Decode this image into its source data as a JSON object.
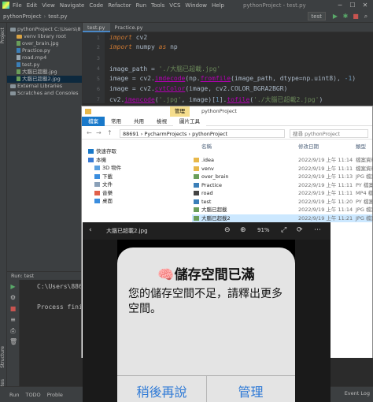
{
  "menubar": {
    "items": [
      "File",
      "Edit",
      "View",
      "Navigate",
      "Code",
      "Refactor",
      "Run",
      "Tools",
      "VCS",
      "Window",
      "Help"
    ],
    "window_title": "pythonProject - test.py"
  },
  "navbar": {
    "crumbs": [
      "pythonProject",
      "test.py"
    ],
    "run_config": "test"
  },
  "left_strip": {
    "project_label": "Project",
    "structure_label": "Structure",
    "favorites_label": "Favorites"
  },
  "project_tree": [
    {
      "label": "pythonProject  C:\\Users\\8",
      "kind": "folder"
    },
    {
      "label": "venv  library root",
      "kind": "folder-orange"
    },
    {
      "label": "over_brain.jpg",
      "kind": "img"
    },
    {
      "label": "Practice.py",
      "kind": "py"
    },
    {
      "label": "road.mp4",
      "kind": "file"
    },
    {
      "label": "test.py",
      "kind": "py"
    },
    {
      "label": "大腦已超載.jpg",
      "kind": "img"
    },
    {
      "label": "大腦已超載2.jpg",
      "kind": "img",
      "selected": true
    },
    {
      "label": "External Libraries",
      "kind": "folder"
    },
    {
      "label": "Scratches and Consoles",
      "kind": "folder"
    }
  ],
  "editor": {
    "tabs": [
      {
        "label": "test.py",
        "active": true
      },
      {
        "label": "Practice.py",
        "active": false
      }
    ],
    "line_numbers": [
      "1",
      "2",
      "3",
      "4",
      "5",
      "6",
      "7"
    ],
    "lines": [
      "import cv2",
      "import numpy as np",
      "",
      "image_path = './大腦已超載.jpg'",
      "image = cv2.imdecode(np.fromfile(image_path, dtype=np.uint8), -1)",
      "image = cv2.cvtColor(image, cv2.COLOR_BGRA2BGR)",
      "cv2.imencode('.jpg', image)[1].tofile('./大腦已超載2.jpg')"
    ]
  },
  "run_panel": {
    "header": "Run:   test",
    "output_lines": [
      "C:\\Users\\8869",
      "",
      "Process finis"
    ]
  },
  "statusbar": {
    "items": [
      "Run",
      "TODO",
      "Proble"
    ],
    "right": "Event Log"
  },
  "explorer": {
    "manage_tab": "管理",
    "title": "pythonProject",
    "ribbon_tabs": [
      "檔案",
      "常用",
      "共用",
      "檢視",
      "圖片工具"
    ],
    "address": "88691 › PycharmProjects › pythonProject",
    "search_placeholder": "搜尋 pythonProject",
    "nav_items": [
      "快速存取",
      "本機",
      "3D 物件",
      "下載",
      "文件",
      "音樂",
      "桌面"
    ],
    "columns": [
      "名稱",
      "修改日期",
      "類型"
    ],
    "files": [
      {
        "name": ".idea",
        "date": "2022/9/19 上午 11:14",
        "type": "檔案資料",
        "kind": "folder"
      },
      {
        "name": "venv",
        "date": "2022/9/19 上午 11:11",
        "type": "檔案資料",
        "kind": "folder"
      },
      {
        "name": "over_brain",
        "date": "2022/9/19 上午 11:13",
        "type": "JPG 檔案",
        "kind": "img"
      },
      {
        "name": "Practice",
        "date": "2022/9/19 上午 11:11",
        "type": "PY 檔案",
        "kind": "py"
      },
      {
        "name": "road",
        "date": "2022/9/19 上午 11:11",
        "type": "MP4 檔案",
        "kind": "file"
      },
      {
        "name": "test",
        "date": "2022/9/19 上午 11:20",
        "type": "PY 檔案",
        "kind": "py"
      },
      {
        "name": "大腦已超載",
        "date": "2022/9/19 上午 11:14",
        "type": "JPG 檔案",
        "kind": "img"
      },
      {
        "name": "大腦已超載2",
        "date": "2022/9/19 上午 11:21",
        "type": "JPG 檔案",
        "kind": "img",
        "selected": true
      }
    ]
  },
  "phone": {
    "title": "大腦已超載2.jpg",
    "zoom": "91%",
    "dialog_title": "🧠儲存空間已滿",
    "dialog_body": "您的儲存空間不足，請釋出更多空間。",
    "btn_later": "稍後再說",
    "btn_manage": "管理"
  }
}
